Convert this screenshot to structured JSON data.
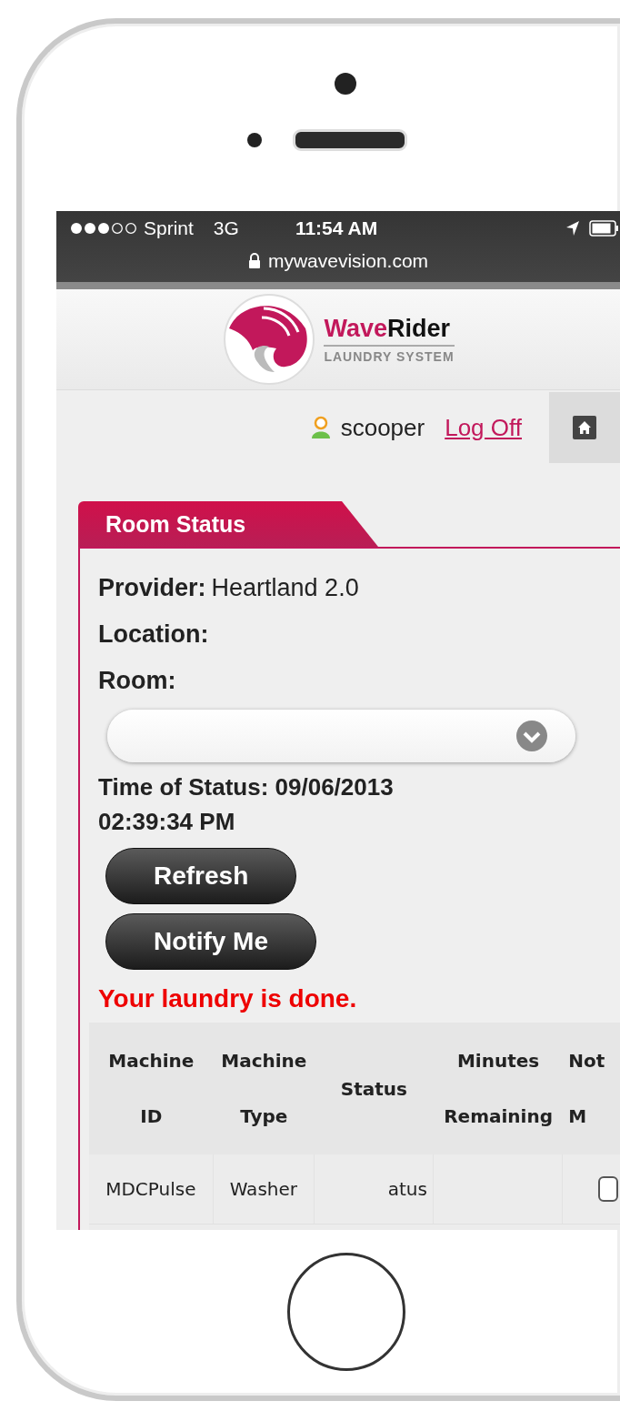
{
  "status_bar": {
    "carrier": "Sprint",
    "network": "3G",
    "time": "11:54 AM",
    "url": "mywavevision.com"
  },
  "logo": {
    "name": [
      "Wave",
      "Rider"
    ],
    "tagline": "LAUNDRY SYSTEM"
  },
  "user": {
    "name": "scooper",
    "log_off": "Log Off"
  },
  "panel": {
    "tab": "Room Status",
    "fields": [
      {
        "label": "Provider:",
        "value": "Heartland 2.0"
      },
      {
        "label": "Location:"
      },
      {
        "label": "Room:"
      }
    ],
    "time_of_status": "Time of Status: 09/06/2013 02:39:34 PM",
    "buttons": [
      "Refresh",
      "Notify Me"
    ],
    "message": "Your laundry is done."
  },
  "table": {
    "columns": [
      {
        "lines": [
          "Machine",
          "ID"
        ]
      },
      {
        "lines": [
          "Machine",
          "Type"
        ]
      },
      {
        "lines": [
          "Status"
        ]
      },
      {
        "lines": [
          "Minutes",
          "Remaining"
        ]
      },
      {
        "lines": [
          "Not",
          "M"
        ]
      }
    ],
    "rows": [
      {
        "machine_id": "MDCPulse",
        "machine_type": "Washer",
        "status": "atus",
        "notify": false
      }
    ]
  }
}
